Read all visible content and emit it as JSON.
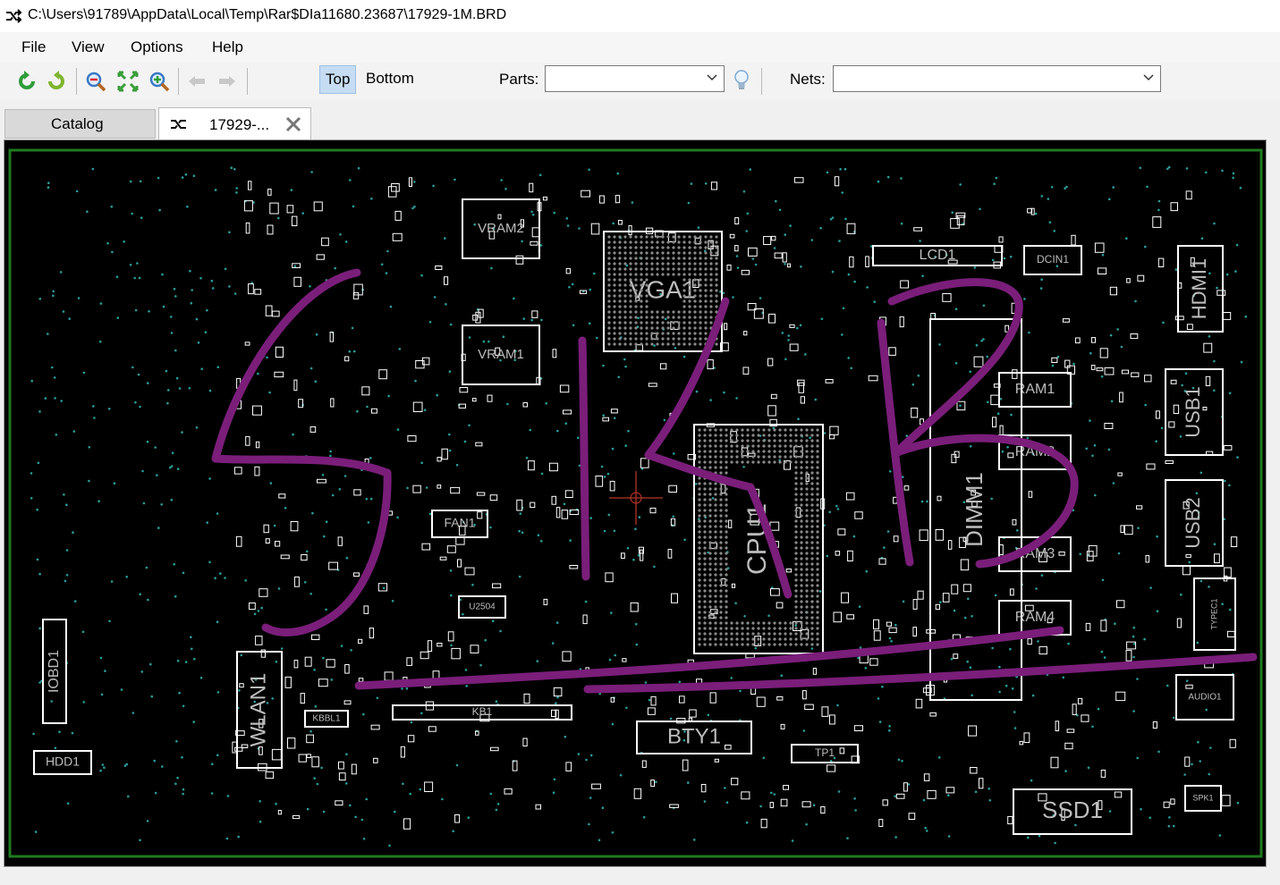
{
  "window": {
    "title": "C:\\Users\\91789\\AppData\\Local\\Temp\\Rar$DIa11680.23687\\17929-1M.BRD"
  },
  "menu": {
    "items": [
      "File",
      "View",
      "Options",
      "Help"
    ]
  },
  "toolbar": {
    "top_label": "Top",
    "bottom_label": "Bottom",
    "parts_label": "Parts:",
    "parts_value": "",
    "nets_label": "Nets:",
    "nets_value": ""
  },
  "tabs": [
    {
      "label": "Catalog"
    },
    {
      "label": "17929-..."
    }
  ],
  "board": {
    "component_labels": [
      "VRAM2",
      "VRAM1",
      "VGA1",
      "LCD1",
      "DCIN1",
      "HDMI1",
      "RAM1",
      "RAM2",
      "RAM3",
      "RAM4",
      "DIMM1",
      "USB1",
      "USB2",
      "CPU1",
      "FAN1",
      "U2504",
      "IOBD1",
      "WLAN1",
      "KBBL1",
      "KB1",
      "BTY1",
      "TP1",
      "HDD1",
      "TYPEC1",
      "AUDIO1",
      "SSD1",
      "SPK1"
    ],
    "handwritten_annotation": "S15B",
    "colors": {
      "background": "#000000",
      "outline": "#ffffff",
      "board_edge": "#1f7a1f",
      "vias": "#2a9d9d",
      "annotation": "#7a1e7a",
      "cursor": "#c0392b"
    }
  }
}
